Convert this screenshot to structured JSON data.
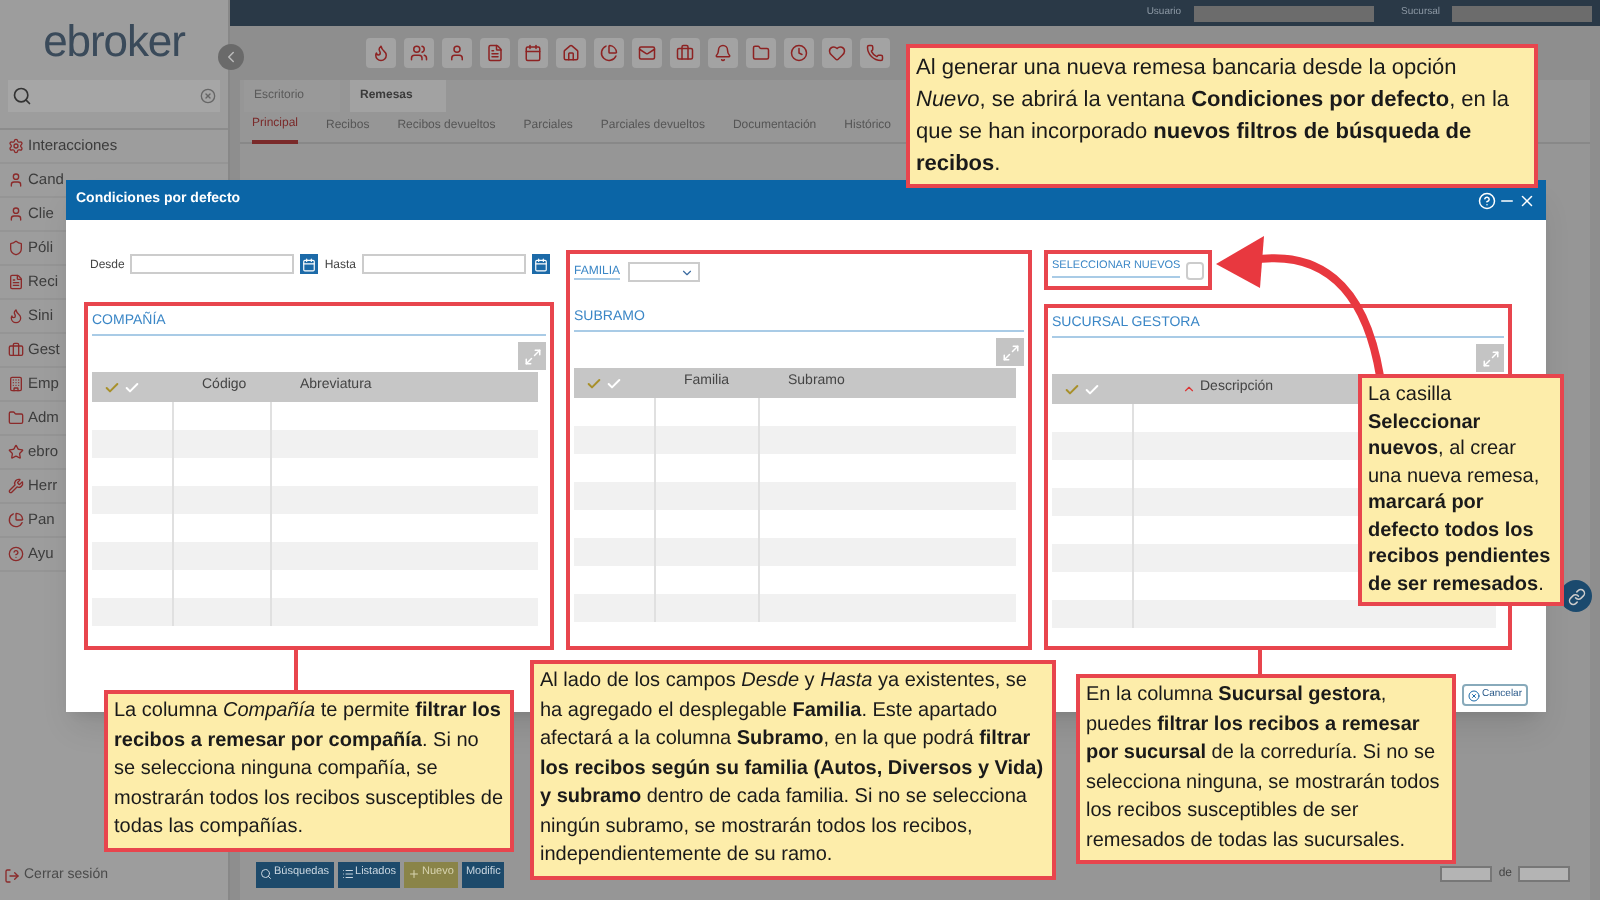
{
  "app": {
    "logo": "ebroker",
    "header": {
      "user_label": "Usuario",
      "branch_label": "Sucursal"
    },
    "sidebar": {
      "items": [
        "Interacciones",
        "Cand",
        "Clie",
        "Póli",
        "Reci",
        "Sini",
        "Gest",
        "Emp",
        "Adm",
        "ebro",
        "Herr",
        "Pan",
        "Ayu"
      ],
      "logout": "Cerrar sesión"
    },
    "tabs": [
      {
        "label": "Escritorio",
        "selected": false
      },
      {
        "label": "Remesas",
        "selected": true
      }
    ],
    "subtabs": [
      {
        "label": "Principal",
        "selected": true
      },
      {
        "label": "Recibos",
        "selected": false
      },
      {
        "label": "Recibos devueltos",
        "selected": false
      },
      {
        "label": "Parciales",
        "selected": false
      },
      {
        "label": "Parciales devueltos",
        "selected": false
      },
      {
        "label": "Documentación",
        "selected": false
      },
      {
        "label": "Histórico",
        "selected": false
      }
    ],
    "bottom_buttons": [
      {
        "label": "Búsquedas",
        "kind": "search"
      },
      {
        "label": "Listados",
        "kind": "list"
      },
      {
        "label": "Nuevo",
        "kind": "new"
      },
      {
        "label": "Modific",
        "kind": "edit"
      }
    ],
    "pagination": {
      "of_label": "de"
    }
  },
  "dialog": {
    "title": "Condiciones por defecto",
    "date_from_label": "Desde",
    "date_to_label": "Hasta",
    "company": {
      "title": "COMPAÑÍA",
      "columns": [
        "Código",
        "Abreviatura"
      ]
    },
    "family": {
      "label": "FAMILIA"
    },
    "subbranch": {
      "title": "SUBRAMO",
      "columns": [
        "Familia",
        "Subramo"
      ]
    },
    "select_new": {
      "label": "SELECCIONAR NUEVOS",
      "checked": false
    },
    "branch": {
      "title": "SUCURSAL GESTORA",
      "columns": [
        "Descripción"
      ]
    },
    "cancel": "Cancelar"
  },
  "callouts": [
    {
      "text": "Al generar una nueva remesa bancaria desde la opción *Nuevo*, se abrirá la ventana **Condiciones por defecto**, en la que se han incorporado **nuevos filtros de búsqueda de recibos**."
    },
    {
      "text": "La casilla **Seleccionar nuevos**, al crear una nueva remesa, **marcará por defecto todos los recibos pendientes de ser remesados**."
    },
    {
      "text": "La columna *Compañía* te permite **filtrar los recibos a remesar por compañía**. Si no se selecciona ninguna compañía, se mostrarán todos los recibos susceptibles de todas las compañías."
    },
    {
      "text": "Al lado de los campos *Desde* y *Hasta* ya existentes, se ha agregado el desplegable **Familia**. Este apartado afectará a la columna **Subramo**, en la que podrá **filtrar los recibos según su familia (Autos, Diversos y Vida) y subramo** dentro de cada familia. Si no se selecciona ningún subramo, se mostrarán todos los recibos, independientemente de su ramo."
    },
    {
      "text": "En la columna **Sucursal gestora**, puedes **filtrar los recibos a remesar por sucursal** de la correduría. Si no se selecciona ninguna, se mostrarán todos los recibos susceptibles de ser remesados de todas las sucursales."
    }
  ]
}
